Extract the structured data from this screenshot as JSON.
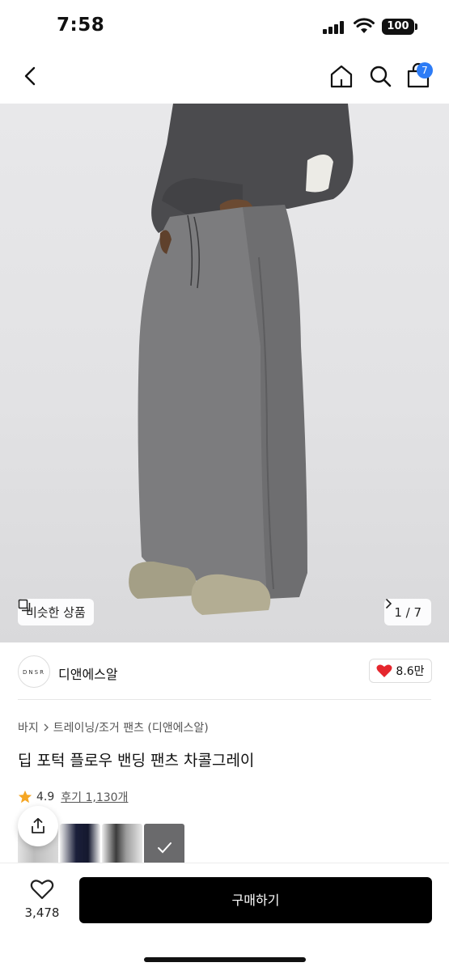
{
  "status_bar": {
    "time": "7:58",
    "battery": "100"
  },
  "nav": {
    "back_icon": "chevron-left-icon",
    "home_icon": "home-icon",
    "search_icon": "search-icon",
    "bag_icon": "shopping-bag-icon",
    "bag_count": "7"
  },
  "hero": {
    "similar_label": "비슷한 상품",
    "counter": "1 / 7"
  },
  "brand": {
    "logo_text": "DNSR",
    "name": "디앤에스알",
    "likes": "8.6만"
  },
  "product": {
    "breadcrumb": [
      "바지",
      "트레이닝/조거 팬츠 (디앤에스알)"
    ],
    "title": "딥 포턱 플로우 밴딩 팬츠 차콜그레이",
    "rating": "4.9",
    "reviews": "후기 1,130개"
  },
  "bottom_bar": {
    "wish_count": "3,478",
    "buy_label": "구매하기"
  },
  "colors": {
    "accent": "#2d7cf6",
    "heart": "#e5262d",
    "star": "#f5a623",
    "button": "#000000"
  }
}
